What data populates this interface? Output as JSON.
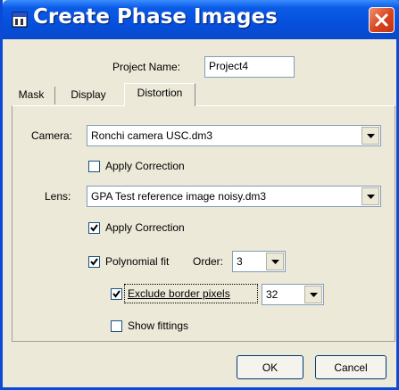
{
  "window": {
    "title": "Create Phase Images"
  },
  "project": {
    "label": "Project Name:",
    "value": "Project4"
  },
  "tabs": [
    {
      "label": "Mask"
    },
    {
      "label": "Display"
    },
    {
      "label": "Distortion",
      "active": true
    }
  ],
  "camera": {
    "label": "Camera:",
    "selected": "Ronchi camera USC.dm3",
    "apply_correction": {
      "label": "Apply Correction",
      "checked": false
    }
  },
  "lens": {
    "label": "Lens:",
    "selected": "GPA Test reference image noisy.dm3",
    "apply_correction": {
      "label": "Apply Correction",
      "checked": true
    },
    "polynomial_fit": {
      "label": "Polynomial fit",
      "checked": true
    },
    "order": {
      "label": "Order:",
      "selected": "3"
    },
    "exclude_border": {
      "label": "Exclude border pixels",
      "checked": true,
      "value": "32"
    },
    "show_fittings": {
      "label": "Show fittings",
      "checked": false
    }
  },
  "buttons": {
    "ok": "OK",
    "cancel": "Cancel"
  },
  "icons": {
    "app": "window-icon",
    "close": "close-icon",
    "dropdown": "dropdown-arrow-icon",
    "check": "checkmark-icon"
  },
  "colors": {
    "titlebar": "#0550dd",
    "close": "#d8431f",
    "dialog": "#ece9d8"
  }
}
